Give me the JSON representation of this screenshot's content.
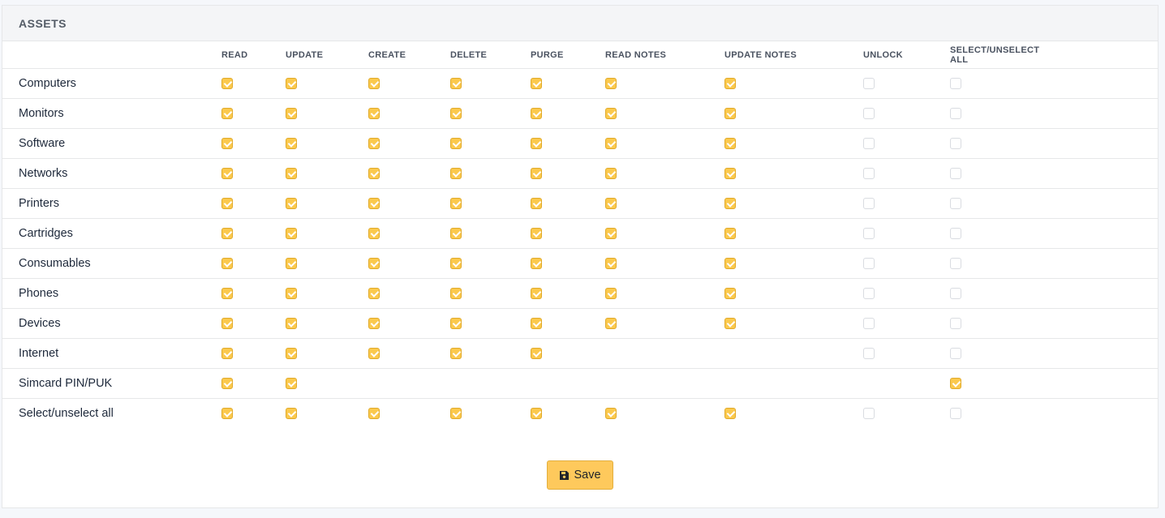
{
  "section": {
    "title": "ASSETS"
  },
  "columns": [
    "READ",
    "UPDATE",
    "CREATE",
    "DELETE",
    "PURGE",
    "READ NOTES",
    "UPDATE NOTES",
    "UNLOCK",
    "SELECT/UNSELECT ALL"
  ],
  "rows": [
    {
      "label": "Computers",
      "cells": [
        1,
        1,
        1,
        1,
        1,
        1,
        1,
        0,
        0
      ]
    },
    {
      "label": "Monitors",
      "cells": [
        1,
        1,
        1,
        1,
        1,
        1,
        1,
        0,
        0
      ]
    },
    {
      "label": "Software",
      "cells": [
        1,
        1,
        1,
        1,
        1,
        1,
        1,
        0,
        0
      ]
    },
    {
      "label": "Networks",
      "cells": [
        1,
        1,
        1,
        1,
        1,
        1,
        1,
        0,
        0
      ]
    },
    {
      "label": "Printers",
      "cells": [
        1,
        1,
        1,
        1,
        1,
        1,
        1,
        0,
        0
      ]
    },
    {
      "label": "Cartridges",
      "cells": [
        1,
        1,
        1,
        1,
        1,
        1,
        1,
        0,
        0
      ]
    },
    {
      "label": "Consumables",
      "cells": [
        1,
        1,
        1,
        1,
        1,
        1,
        1,
        0,
        0
      ]
    },
    {
      "label": "Phones",
      "cells": [
        1,
        1,
        1,
        1,
        1,
        1,
        1,
        0,
        0
      ]
    },
    {
      "label": "Devices",
      "cells": [
        1,
        1,
        1,
        1,
        1,
        1,
        1,
        0,
        0
      ]
    },
    {
      "label": "Internet",
      "cells": [
        1,
        1,
        1,
        1,
        1,
        null,
        null,
        0,
        0
      ]
    },
    {
      "label": "Simcard PIN/PUK",
      "cells": [
        1,
        1,
        null,
        null,
        null,
        null,
        null,
        null,
        1
      ]
    },
    {
      "label": "Select/unselect all",
      "cells": [
        1,
        1,
        1,
        1,
        1,
        1,
        1,
        0,
        0
      ]
    }
  ],
  "save_button": {
    "label": "Save",
    "icon": "floppy-disk-icon"
  },
  "colors": {
    "accent": "#fbc94d",
    "button": "#fec95c"
  }
}
